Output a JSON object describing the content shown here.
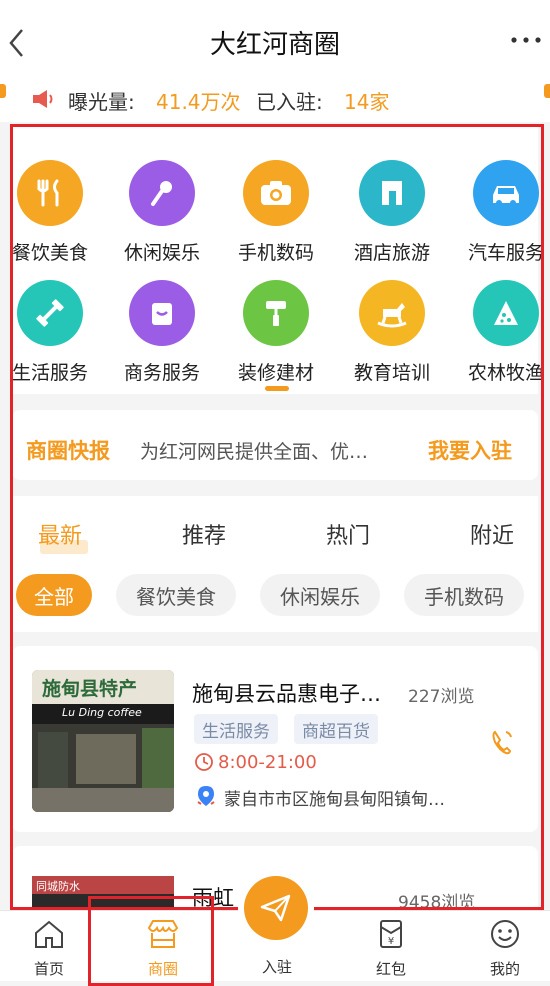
{
  "header": {
    "title": "大红河商圈"
  },
  "stats": {
    "exposure_label": "曝光量:",
    "exposure_value": "41.4万次",
    "joined_label": "已入驻:",
    "joined_value": "14家"
  },
  "categories": [
    {
      "label": "餐饮美食",
      "icon": "fork-knife-icon",
      "color": "#f5a623"
    },
    {
      "label": "休闲娱乐",
      "icon": "microphone-icon",
      "color": "#9b5de5"
    },
    {
      "label": "手机数码",
      "icon": "camera-icon",
      "color": "#f5a623"
    },
    {
      "label": "酒店旅游",
      "icon": "hotel-icon",
      "color": "#2bb7c9"
    },
    {
      "label": "汽车服务",
      "icon": "car-icon",
      "color": "#2fa3f0"
    },
    {
      "label": "生活服务",
      "icon": "dumbbell-icon",
      "color": "#25c6b8"
    },
    {
      "label": "商务服务",
      "icon": "bag-icon",
      "color": "#9b5de5"
    },
    {
      "label": "装修建材",
      "icon": "paint-roller-icon",
      "color": "#6cc644"
    },
    {
      "label": "教育培训",
      "icon": "rocking-horse-icon",
      "color": "#f5b623"
    },
    {
      "label": "农林牧渔",
      "icon": "watermelon-icon",
      "color": "#25c6b8"
    }
  ],
  "news": {
    "title": "商圈快报",
    "text": "为红河网民提供全面、优…",
    "join_button": "我要入驻"
  },
  "tabs": [
    "最新",
    "推荐",
    "热门",
    "附近"
  ],
  "chips": [
    "全部",
    "餐饮美食",
    "休闲娱乐",
    "手机数码"
  ],
  "store": {
    "sign_text": "施甸县特产",
    "sign_sub": "Lu Ding coffee",
    "name": "施甸县云品惠电子…",
    "views": "227浏览",
    "tags": [
      "生活服务",
      "商超百货"
    ],
    "hours": "8:00-21:00",
    "address": "蒙自市市区施甸县甸阳镇甸…"
  },
  "store2": {
    "name": "雨虹",
    "views": "9458浏览",
    "img_text": "同城防水"
  },
  "nav": {
    "home": "首页",
    "shop": "商圈",
    "join": "入驻",
    "redpack": "红包",
    "mine": "我的"
  }
}
